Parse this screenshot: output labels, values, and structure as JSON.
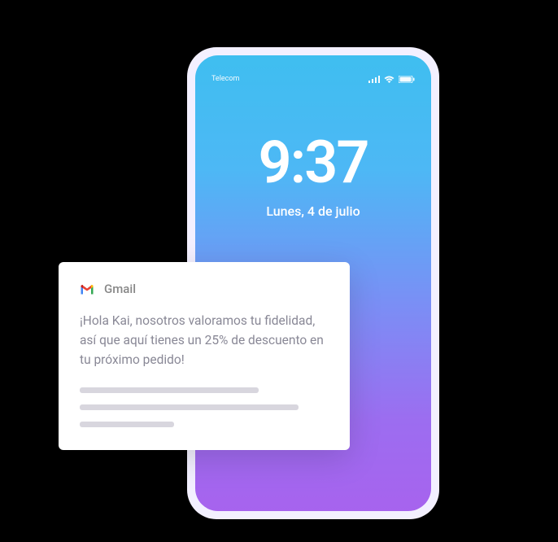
{
  "statusBar": {
    "carrier": "Telecom"
  },
  "clock": {
    "time": "9:37",
    "date": "Lunes, 4 de julio"
  },
  "notification": {
    "app": "Gmail",
    "body": "¡Hola Kai, nosotros valoramos tu fidelidad, así que aquí tienes un 25% de descuento en tu próximo pedido!"
  }
}
